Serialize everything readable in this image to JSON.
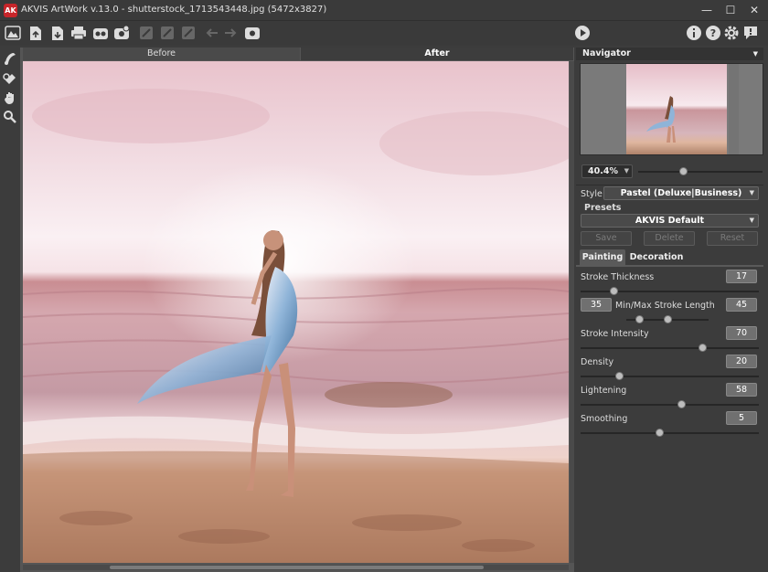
{
  "window": {
    "app_logo": "AK",
    "title": "AKVIS ArtWork v.13.0 - shutterstock_1713543448.jpg (5472x3827)",
    "minimize": "—",
    "maximize": "☐",
    "close": "✕"
  },
  "toolbar": {
    "icons": [
      "home-icon",
      "open-file-icon",
      "save-file-icon",
      "print-icon",
      "batch-icon",
      "plugin-icon",
      "canvas-icon",
      "share-icon",
      "clear-icon",
      "undo-icon",
      "redo-icon",
      "settings-gear-icon",
      "run-icon",
      "info-icon",
      "help-icon",
      "preferences-icon",
      "news-icon"
    ]
  },
  "canvas": {
    "tab_before": "Before",
    "tab_after": "After"
  },
  "navigator": {
    "title": "Navigator",
    "zoom": "40.4%",
    "zoom_level": 0.45
  },
  "style": {
    "label": "Style:",
    "value": "Pastel (Deluxe|Business)"
  },
  "presets": {
    "label": "Presets",
    "value": "AKVIS Default",
    "save": "Save",
    "delete": "Delete",
    "reset": "Reset"
  },
  "tabs": {
    "painting": "Painting",
    "decoration": "Decoration"
  },
  "params": {
    "stroke_thickness": {
      "label": "Stroke Thickness",
      "value": "17",
      "level": 0.17
    },
    "stroke_length": {
      "label": "Min/Max Stroke Length",
      "min": "35",
      "max": "45",
      "min_level": 0.35,
      "max_level": 0.45
    },
    "stroke_intensity": {
      "label": "Stroke Intensity",
      "value": "70",
      "level": 0.7
    },
    "density": {
      "label": "Density",
      "value": "20",
      "level": 0.2
    },
    "lightening": {
      "label": "Lightening",
      "value": "58",
      "level": 0.58
    },
    "smoothing": {
      "label": "Smoothing",
      "value": "5",
      "level": 0.45
    }
  }
}
